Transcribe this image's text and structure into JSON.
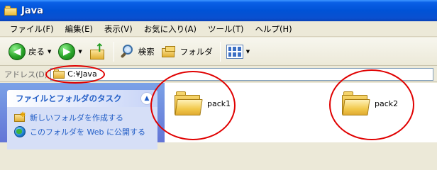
{
  "window": {
    "title": "Java"
  },
  "menu": [
    "ファイル(F)",
    "編集(E)",
    "表示(V)",
    "お気に入り(A)",
    "ツール(T)",
    "ヘルプ(H)"
  ],
  "toolbar": {
    "back_label": "戻る",
    "search_label": "検索",
    "folders_label": "フォルダ"
  },
  "address": {
    "label": "アドレス(D)",
    "value": "C:¥Java"
  },
  "task_pane": {
    "title": "ファイルとフォルダのタスク",
    "items": [
      "新しいフォルダを作成する",
      "このフォルダを Web に公開する"
    ]
  },
  "files": [
    "pack1",
    "pack2"
  ],
  "annotation": {
    "color": "#e00000"
  }
}
